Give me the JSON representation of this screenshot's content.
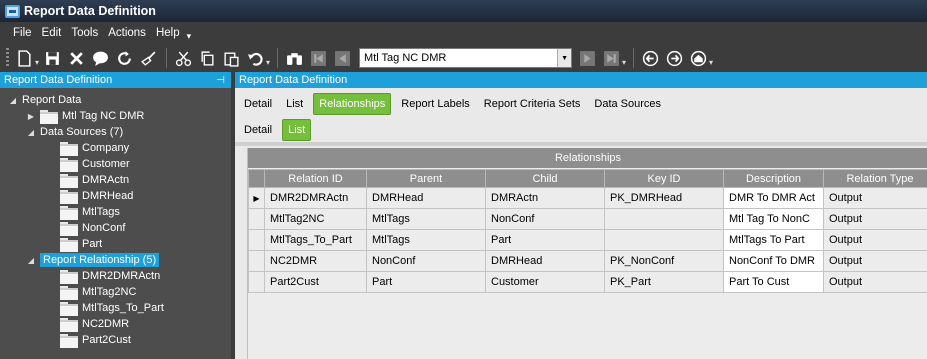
{
  "window": {
    "title": "Report Data Definition"
  },
  "menu": [
    "File",
    "Edit",
    "Tools",
    "Actions",
    "Help"
  ],
  "toolbar": {
    "record_value": "Mtl Tag NC DMR"
  },
  "left_panel": {
    "header": "Report Data Definition",
    "tree": {
      "root": "Report Data",
      "record": "Mtl Tag NC DMR",
      "data_sources_label": "Data Sources (7)",
      "data_sources": [
        "Company",
        "Customer",
        "DMRActn",
        "DMRHead",
        "MtlTags",
        "NonConf",
        "Part"
      ],
      "relationships_label": "Report Relationship (5)",
      "relationships": [
        "DMR2DMRActn",
        "MtlTag2NC",
        "MtlTags_To_Part",
        "NC2DMR",
        "Part2Cust"
      ]
    }
  },
  "right_panel": {
    "header": "Report Data Definition",
    "tabs": [
      "Detail",
      "List",
      "Relationships",
      "Report Labels",
      "Report Criteria Sets",
      "Data Sources"
    ],
    "subtabs": [
      "Detail",
      "List"
    ],
    "grid": {
      "title": "Relationships",
      "columns": [
        "Relation ID",
        "Parent",
        "Child",
        "Key ID",
        "Description",
        "Relation Type"
      ],
      "rows": [
        [
          "DMR2DMRActn",
          "DMRHead",
          "DMRActn",
          "PK_DMRHead",
          "DMR To DMR Act",
          "Output"
        ],
        [
          "MtlTag2NC",
          "MtlTags",
          "NonConf",
          "",
          "Mtl Tag  To NonC",
          "Output"
        ],
        [
          "MtlTags_To_Part",
          "MtlTags",
          "Part",
          "",
          "MtlTags To Part",
          "Output"
        ],
        [
          "NC2DMR",
          "NonConf",
          "DMRHead",
          "PK_NonConf",
          "NonConf To DMR",
          "Output"
        ],
        [
          "Part2Cust",
          "Part",
          "Customer",
          "PK_Part",
          "Part To Cust",
          "Output"
        ]
      ]
    }
  },
  "colors": {
    "accent": "#1ea0da",
    "active_tab": "#76bf3c",
    "panel_dark": "#4d4d4d"
  }
}
